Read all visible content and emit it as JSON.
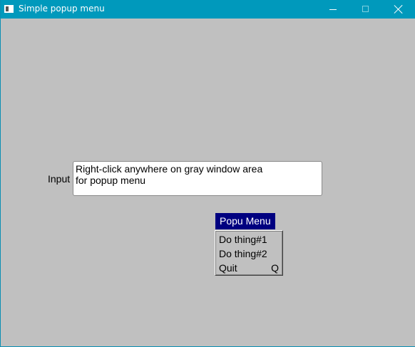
{
  "window": {
    "title": "Simple popup menu",
    "icon": "app-window-icon",
    "controls": [
      "minimize-icon",
      "maximize-icon",
      "close-icon"
    ]
  },
  "form": {
    "input_label": "Input",
    "input_lines": [
      "Right-click anywhere on gray window area",
      "for popup menu"
    ]
  },
  "popup": {
    "title": "Popu Menu",
    "items": [
      {
        "label": "Do thing#1",
        "shortcut": ""
      },
      {
        "label": "Do thing#2",
        "shortcut": ""
      },
      {
        "label": "Quit",
        "shortcut": "Q"
      }
    ]
  },
  "colors": {
    "titlebar": "#0099bc",
    "background": "#c0c0c0",
    "menu_title_bg": "#000080"
  }
}
